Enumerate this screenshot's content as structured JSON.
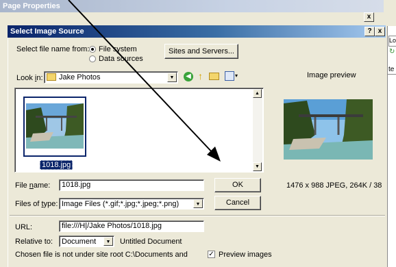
{
  "outer_window": {
    "title": "Page Properties",
    "close": "x"
  },
  "dialog": {
    "title": "Select Image Source",
    "help": "?",
    "close": "x"
  },
  "select_from": {
    "label": "Select file name from:",
    "option_file_system": "File system",
    "option_data_sources": "Data sources",
    "selected": "File system"
  },
  "sites_button": "Sites and Servers...",
  "look_in": {
    "label": "Look in:",
    "value": "Jake Photos"
  },
  "files": [
    {
      "name": "1018.jpg",
      "selected": true
    }
  ],
  "file_name": {
    "label": "File name:",
    "value": "1018.jpg"
  },
  "files_of_type": {
    "label": "Files of type:",
    "value": "Image Files (*.gif;*.jpg;*.jpeg;*.png)"
  },
  "ok_button": "OK",
  "cancel_button": "Cancel",
  "url": {
    "label": "URL:",
    "value": "file:///H|/Jake Photos/1018.jpg"
  },
  "relative_to": {
    "label": "Relative to:",
    "value": "Document",
    "doc_name": "Untitled Document"
  },
  "status_text": "Chosen file is not under site root C:\\Documents and",
  "preview": {
    "heading": "Image preview",
    "info": "1476 x 988 JPEG, 264K / 38",
    "checkbox_label": "Preview images",
    "checked": true
  },
  "side_panel_fragments": {
    "lo": "Lo",
    "te": "te"
  },
  "colors": {
    "title_blue": "#0a246a",
    "dialog_bg": "#ece9d8",
    "selection": "#0a246a"
  }
}
